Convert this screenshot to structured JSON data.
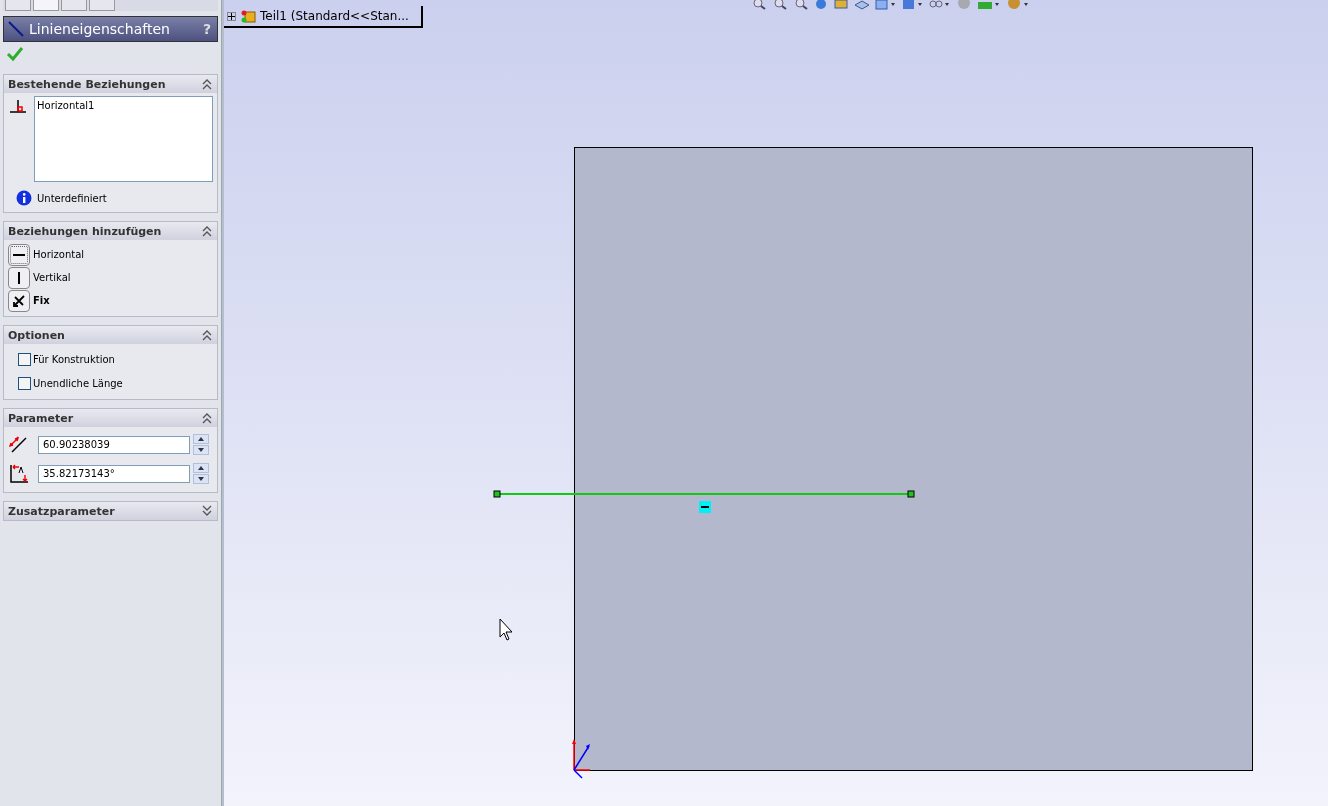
{
  "panel": {
    "title": "Linieneigenschaften",
    "help": "?"
  },
  "sections": [
    {
      "kind": "relations",
      "title": "Bestehende Beziehungen",
      "expanded": true,
      "relations": [
        "Horizontal1"
      ],
      "status": "Unterdefiniert"
    },
    {
      "kind": "add",
      "title": "Beziehungen hinzufügen",
      "expanded": true,
      "items": [
        {
          "label": "Horizontal",
          "focused": true
        },
        {
          "label": "Vertikal",
          "focused": false
        },
        {
          "label": "Fix",
          "focused": false
        }
      ]
    },
    {
      "kind": "options",
      "title": "Optionen",
      "expanded": true,
      "items": [
        {
          "label": "Für Konstruktion",
          "checked": false
        },
        {
          "label": "Unendliche Länge",
          "checked": false
        }
      ]
    },
    {
      "kind": "params",
      "title": "Parameter",
      "expanded": true,
      "fields": [
        {
          "value": "60.90238039"
        },
        {
          "value": "35.82173143°"
        }
      ]
    },
    {
      "title": "Zusatzparameter",
      "expanded": false
    }
  ],
  "tree": {
    "label": "Teil1  (Standard<<Stan...",
    "expanded": false
  }
}
